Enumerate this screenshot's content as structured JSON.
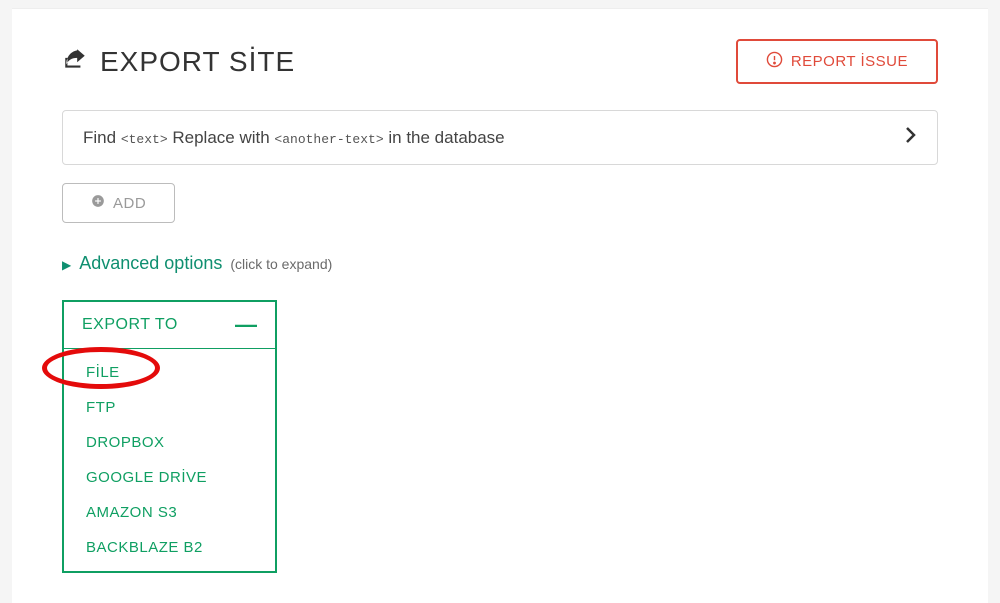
{
  "header": {
    "title": "EXPORT SİTE",
    "report_label": "REPORT İSSUE"
  },
  "find_replace": {
    "prefix": "Find",
    "token1": "<text>",
    "mid": "Replace with",
    "token2": "<another-text>",
    "suffix": "in the database"
  },
  "add_button": {
    "label": "ADD"
  },
  "advanced": {
    "label": "Advanced options",
    "hint": "(click to expand)"
  },
  "export_menu": {
    "header": "EXPORT TO",
    "items": [
      "FİLE",
      "FTP",
      "DROPBOX",
      "GOOGLE DRİVE",
      "AMAZON S3",
      "BACKBLAZE B2"
    ]
  },
  "colors": {
    "accent_green": "#0f9f62",
    "accent_red": "#e04a3a",
    "highlight_red": "#e40b0b"
  }
}
